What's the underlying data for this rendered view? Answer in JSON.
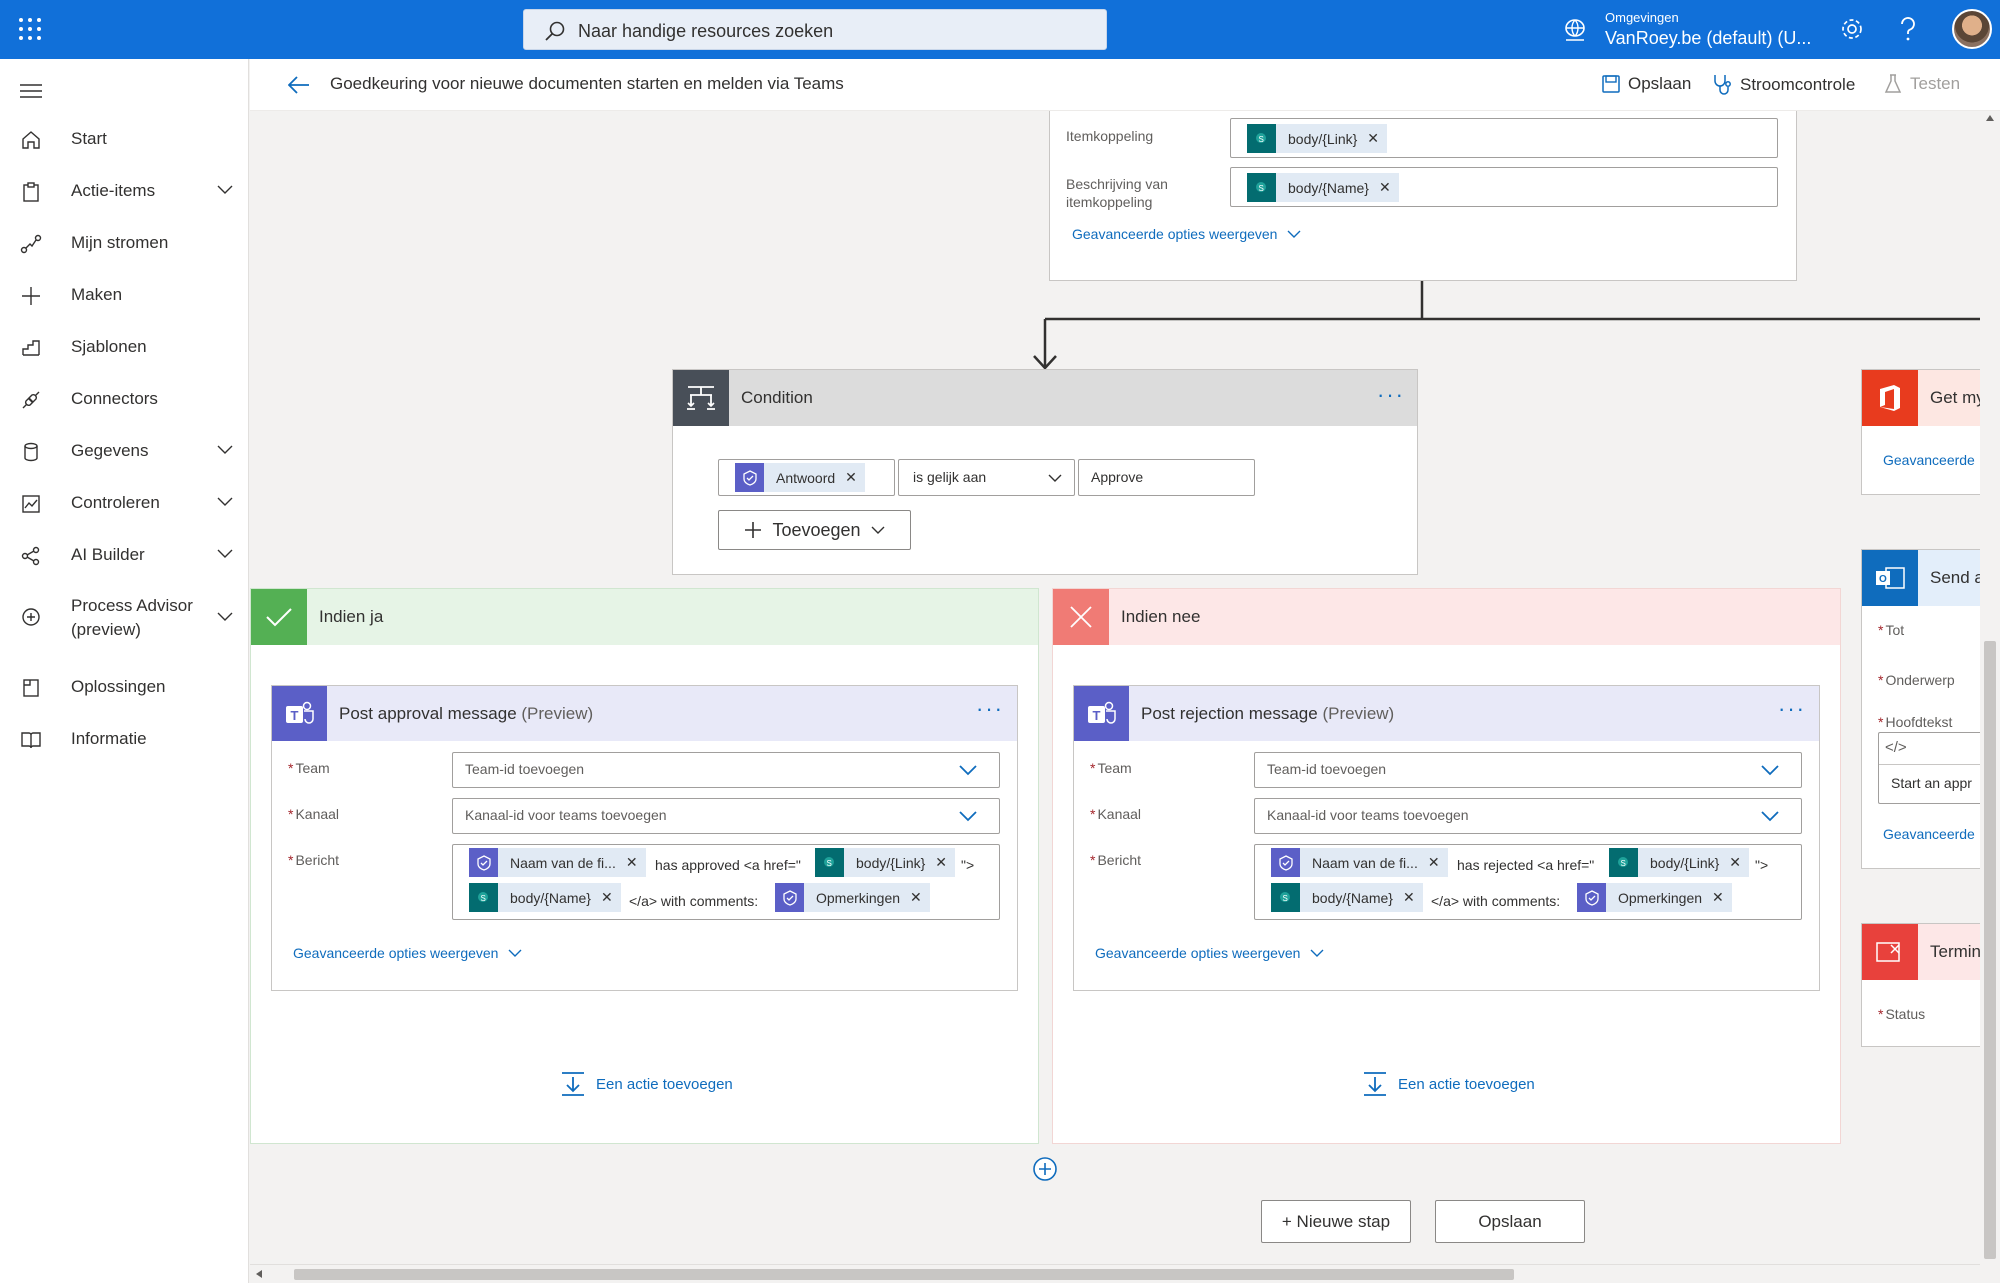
{
  "topbar": {
    "search_placeholder": "Naar handige resources zoeken",
    "env_label": "Omgevingen",
    "env_value": "VanRoey.be (default) (U..."
  },
  "sidebar": {
    "items": [
      {
        "label": "Start",
        "icon": "home-icon"
      },
      {
        "label": "Actie-items",
        "icon": "clipboard-icon",
        "expandable": true
      },
      {
        "label": "Mijn stromen",
        "icon": "flow-icon"
      },
      {
        "label": "Maken",
        "icon": "plus-icon"
      },
      {
        "label": "Sjablonen",
        "icon": "templates-icon"
      },
      {
        "label": "Connectors",
        "icon": "connector-icon"
      },
      {
        "label": "Gegevens",
        "icon": "database-icon",
        "expandable": true
      },
      {
        "label": "Controleren",
        "icon": "monitor-icon",
        "expandable": true
      },
      {
        "label": "AI Builder",
        "icon": "ai-builder-icon",
        "expandable": true
      },
      {
        "label": "Process Advisor",
        "label2": "(preview)",
        "icon": "process-advisor-icon",
        "expandable": true
      },
      {
        "label": "Oplossingen",
        "icon": "solutions-icon"
      },
      {
        "label": "Informatie",
        "icon": "book-icon"
      }
    ]
  },
  "cmdbar": {
    "title": "Goedkeuring voor nieuwe documenten starten en melden via Teams",
    "save": "Opslaan",
    "checker": "Stroomcontrole",
    "test": "Testen"
  },
  "top_card": {
    "item_link_label": "Itemkoppeling",
    "item_link_token": "body/{Link}",
    "item_desc_label_1": "Beschrijving van",
    "item_desc_label_2": "itemkoppeling",
    "item_desc_token": "body/{Name}",
    "advanced": "Geavanceerde opties weergeven"
  },
  "condition": {
    "title": "Condition",
    "token": "Antwoord",
    "operator": "is gelijk aan",
    "value": "Approve",
    "add": "Toevoegen"
  },
  "yes_branch": {
    "title": "Indien ja",
    "action_title": "Post approval message",
    "action_suffix": "(Preview)",
    "team_label": "Team",
    "team_value": "Team-id toevoegen",
    "channel_label": "Kanaal",
    "channel_value": "Kanaal-id voor teams toevoegen",
    "message_label": "Bericht",
    "msg_token1": "Naam van de fi...",
    "msg_text1": "has approved <a href=\"",
    "msg_token2": "body/{Link}",
    "msg_text2": "\">",
    "msg_token3": "body/{Name}",
    "msg_text3": "</a> with comments:",
    "msg_token4": "Opmerkingen",
    "advanced": "Geavanceerde opties weergeven",
    "add_action": "Een actie toevoegen"
  },
  "no_branch": {
    "title": "Indien nee",
    "action_title": "Post rejection message",
    "action_suffix": "(Preview)",
    "team_label": "Team",
    "team_value": "Team-id toevoegen",
    "channel_label": "Kanaal",
    "channel_value": "Kanaal-id voor teams toevoegen",
    "message_label": "Bericht",
    "msg_token1": "Naam van de fi...",
    "msg_text1": "has rejected <a href=\"",
    "msg_token2": "body/{Link}",
    "msg_text2": "\">",
    "msg_token3": "body/{Name}",
    "msg_text3": "</a> with comments:",
    "msg_token4": "Opmerkingen",
    "advanced": "Geavanceerde opties weergeven",
    "add_action": "Een actie toevoegen"
  },
  "right_cards": {
    "get_title": "Get my",
    "get_advanced": "Geavanceerde",
    "send_title": "Send a",
    "send_to": "Tot",
    "send_subject": "Onderwerp",
    "send_body": "Hoofdtekst",
    "send_body_text": "Start an appr",
    "send_advanced": "Geavanceerde",
    "term_title": "Termin",
    "term_status": "Status"
  },
  "footer": {
    "new_step": "+ Nieuwe stap",
    "save": "Opslaan"
  },
  "colors": {
    "topbar": "#1170d9",
    "accent": "#0f6cbd",
    "yes": "#54b054",
    "no": "#f07b75",
    "teams": "#5b5fc7",
    "sharepoint": "#036c70",
    "office": "#e83b1e",
    "outlook": "#0f6cbd"
  }
}
